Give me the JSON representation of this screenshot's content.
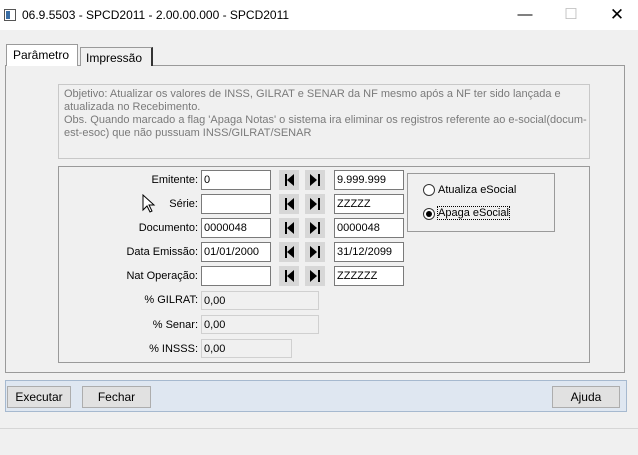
{
  "window": {
    "title": "06.9.5503 - SPCD2011 - 2.00.00.000 - SPCD2011",
    "minimize_glyph": "—",
    "maximize_glyph": "☐",
    "close_glyph": "✕"
  },
  "tabs": [
    {
      "label": "Parâmetro",
      "active": true
    },
    {
      "label": "Impressão",
      "active": false
    }
  ],
  "objective": {
    "lines": [
      "Objetivo: Atualizar os valores de INSS, GILRAT e SENAR da NF mesmo após a NF ter sido lançada e",
      "atualizada no Recebimento.",
      "Obs. Quando marcado a flag 'Apaga Notas' o sistema ira eliminar os registros referente ao e-social(docum-",
      "est-esoc) que não pussuam INSS/GILRAT/SENAR"
    ]
  },
  "fields": {
    "emitente": {
      "label": "Emitente:",
      "from": "0",
      "to": "9.999.999"
    },
    "serie": {
      "label": "Série:",
      "from": "",
      "to": "ZZZZZ"
    },
    "documento": {
      "label": "Documento:",
      "from": "0000048",
      "to": "0000048"
    },
    "data_emissao": {
      "label": "Data Emissão:",
      "from": "01/01/2000",
      "to": "31/12/2099"
    },
    "nat_operacao": {
      "label": "Nat Operação:",
      "from": "",
      "to": "ZZZZZZ"
    },
    "gilrat": {
      "label": "% GILRAT:",
      "value": "0,00"
    },
    "senar": {
      "label": "% Senar:",
      "value": "0,00"
    },
    "insss": {
      "label": "% INSSS:",
      "value": "0,00"
    }
  },
  "radio_options": [
    {
      "label": "Atualiza eSocial",
      "selected": false
    },
    {
      "label": "Apaga eSocial",
      "selected": true
    }
  ],
  "buttons": {
    "executar": "Executar",
    "fechar": "Fechar",
    "ajuda": "Ajuda"
  },
  "icons": {
    "nav_first": "first-record-icon",
    "nav_last": "last-record-icon",
    "cursor": "mouse-pointer-icon"
  }
}
